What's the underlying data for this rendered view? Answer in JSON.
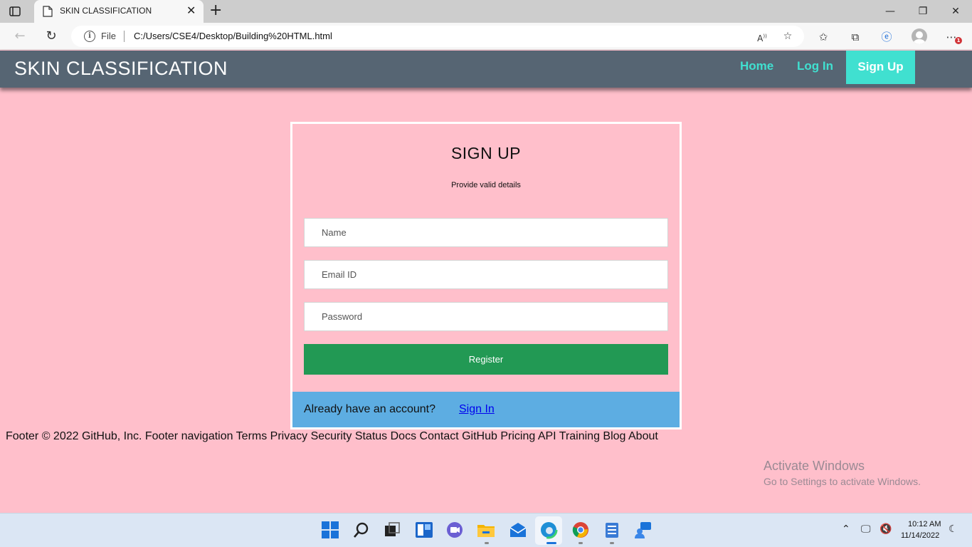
{
  "browser": {
    "tab_title": "SKIN CLASSIFICATION",
    "file_label": "File",
    "url": "C:/Users/CSE4/Desktop/Building%20HTML.html",
    "notification_count": "1"
  },
  "navbar": {
    "brand": "SKIN CLASSIFICATION",
    "links": [
      "Home",
      "Log In"
    ],
    "signup_label": "Sign Up",
    "colors": {
      "bar": "#566573",
      "accent": "#40e0d0"
    }
  },
  "form": {
    "title": "SIGN UP",
    "subtitle": "Provide valid details",
    "name_placeholder": "Name",
    "email_placeholder": "Email ID",
    "password_placeholder": "Password",
    "register_label": "Register",
    "signin_prompt": "Already have an account?",
    "signin_link": "Sign In",
    "colors": {
      "register": "#229954",
      "signin_bar": "#5dade2"
    }
  },
  "footer": {
    "text": "Footer © 2022 GitHub, Inc. Footer navigation Terms Privacy Security Status Docs Contact GitHub Pricing API Training Blog About"
  },
  "watermark": {
    "line1": "Activate Windows",
    "line2": "Go to Settings to activate Windows."
  },
  "taskbar": {
    "time": "10:12 AM",
    "date": "11/14/2022"
  },
  "page_background": "#ffbfcb"
}
